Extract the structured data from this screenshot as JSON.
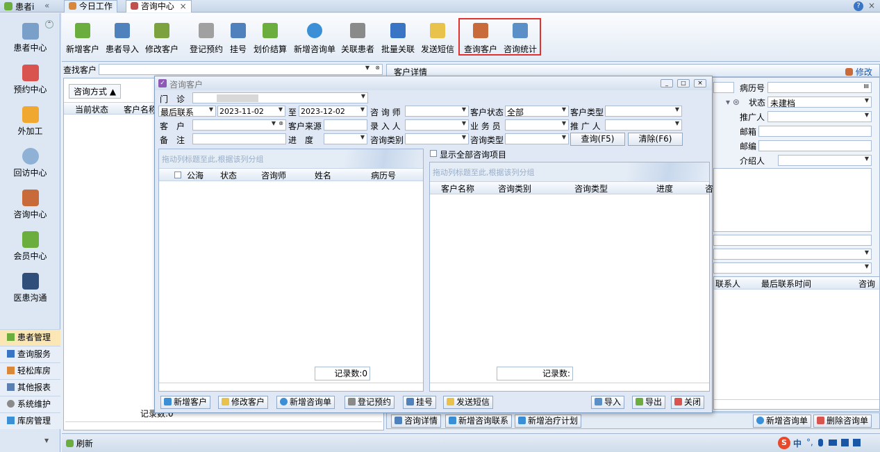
{
  "tabs": {
    "collapsed": "患者i",
    "today": "今日工作",
    "consult": "咨询中心",
    "close": "×"
  },
  "window_controls": {
    "help": "?",
    "close": "×"
  },
  "nav": {
    "items": [
      "患者中心",
      "预约中心",
      "外加工",
      "回访中心",
      "咨询中心",
      "会员中心",
      "医患沟通"
    ],
    "groups": [
      "患者管理",
      "查询服务",
      "轻松库房",
      "其他报表",
      "系统维护",
      "库房管理"
    ],
    "refresh": "刷新"
  },
  "toolbar": {
    "items": [
      "新增客户",
      "患者导入",
      "修改客户",
      "登记预约",
      "挂号",
      "划价结算",
      "新增咨询单",
      "关联患者",
      "批量关联",
      "发送短信",
      "查询客户",
      "咨询统计"
    ]
  },
  "search": {
    "label": "查找客户"
  },
  "left_panel": {
    "filter": "咨询方式 ▲",
    "cols": [
      "当前状态",
      "客户名称"
    ],
    "footer": "记录数:0"
  },
  "detail": {
    "title": "客户详情",
    "edit": "修改",
    "fields": [
      "病历号",
      "状态",
      "推广人",
      "邮箱",
      "邮编",
      "介绍人"
    ],
    "status_value": "未建档",
    "cols": [
      "联系人",
      "最后联系时间",
      "咨询"
    ],
    "bottom_buttons": [
      "咨询详情",
      "新增咨询联系",
      "新增治疗计划"
    ],
    "right_buttons": [
      "新增咨询单",
      "删除咨询单"
    ]
  },
  "dialog": {
    "title": "咨询客户",
    "labels": {
      "clinic": "门　诊",
      "last_contact": "最后联系",
      "to": "至",
      "consultant": "咨 询 师",
      "cust_status": "客户状态",
      "cust_type": "客户类型",
      "customer": "客　户",
      "source": "客户来源",
      "recorder": "录 入 人",
      "salesman": "业 务 员",
      "promoter": "推 广 人",
      "note": "备　注",
      "progress": "进　度",
      "consult_cat": "咨询类别",
      "consult_type": "咨询类型"
    },
    "values": {
      "date_from": "2023-11-02",
      "date_to": "2023-12-02",
      "cust_status": "全部"
    },
    "query_btn": "查询(F5)",
    "clear_btn": "清除(F6)",
    "show_all": "显示全部咨询项目",
    "group_hint": "拖动列标题至此,根据该列分组",
    "left_cols": [
      "公海",
      "状态",
      "咨询师",
      "姓名",
      "病历号"
    ],
    "right_cols": [
      "客户名称",
      "咨询类别",
      "咨询类型",
      "进度",
      "咨"
    ],
    "left_count": "记录数:0",
    "right_count": "记录数:",
    "footer_buttons": [
      "新增客户",
      "修改客户",
      "新增咨询单",
      "登记预约",
      "挂号",
      "发送短信"
    ],
    "footer_right": [
      "导入",
      "导出",
      "关闭"
    ]
  },
  "tray": {
    "ime": "中"
  }
}
